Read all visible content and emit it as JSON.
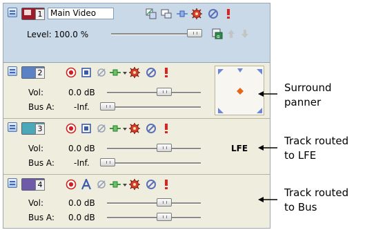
{
  "video_track": {
    "number": "1",
    "name": "Main Video",
    "level_label": "Level: 100.0 %",
    "level": 1.0,
    "chip_color": "#9b1b2b"
  },
  "audio_tracks": [
    {
      "number": "2",
      "vol_label": "Vol:",
      "vol_value": "0.0 dB",
      "bus_label": "Bus A:",
      "bus_value": "-Inf.",
      "chip_color": "#5c82c6",
      "mode_icon": "record-icon"
    },
    {
      "number": "3",
      "vol_label": "Vol:",
      "vol_value": "0.0 dB",
      "bus_label": "Bus A:",
      "bus_value": "-Inf.",
      "chip_color": "#4aa8b8",
      "mode_icon": "record-icon"
    },
    {
      "number": "4",
      "vol_label": "Vol:",
      "vol_value": "0.0 dB",
      "bus_label": "Bus A:",
      "bus_value": "0.0 dB",
      "chip_color": "#6e5aa8",
      "mode_icon": "record-icon"
    }
  ],
  "lfe_label": "LFE",
  "callouts": {
    "surround": [
      "Surround",
      "panner"
    ],
    "lfe": [
      "Track routed",
      "to LFE"
    ],
    "bus": [
      "Track routed",
      "to Bus"
    ]
  },
  "colors": {
    "video_bg": "#c9d9e8",
    "audio_bg": "#efedde",
    "record": "#cc2222",
    "panner_arrow": "#6f86d8",
    "panner_center": "#e06a1a"
  }
}
